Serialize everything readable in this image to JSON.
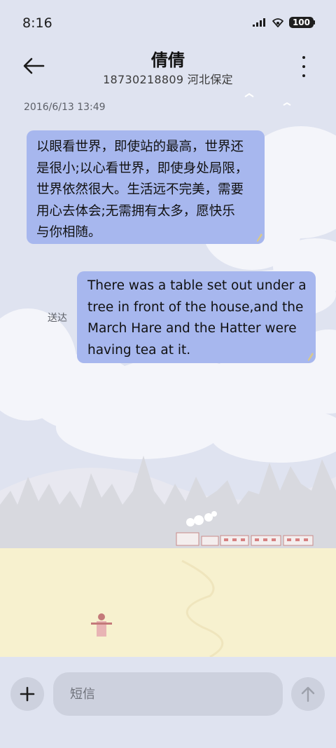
{
  "status_bar": {
    "time": "8:16",
    "battery": "100",
    "icons": [
      "signal-icon",
      "wifi-icon",
      "battery-icon"
    ]
  },
  "header": {
    "contact_name": "倩倩",
    "contact_detail": "18730218809 河北保定"
  },
  "conversation": {
    "timestamp": "2016/6/13 13:49",
    "incoming_message": {
      "lines": [
        "以眼看世界，即使站的最高，世界还",
        "是很小;以心看世界，即使身处局限，",
        "世界依然很大。生活远不完美，需要",
        "用心去体会;无需拥有太多，愿快乐",
        "与你相随。"
      ]
    },
    "outgoing_message": {
      "lines": [
        "There was a table set out under a",
        "tree in front of the house,and the",
        "March Hare and the Hatter were",
        "having tea at it."
      ],
      "status": "送达"
    }
  },
  "composer": {
    "placeholder": "短信",
    "value": ""
  },
  "colors": {
    "background": "#dfe3f0",
    "bubble": "#a7b7ee",
    "button_bg": "#cdd1de",
    "meadow": "#f7f1cf"
  }
}
